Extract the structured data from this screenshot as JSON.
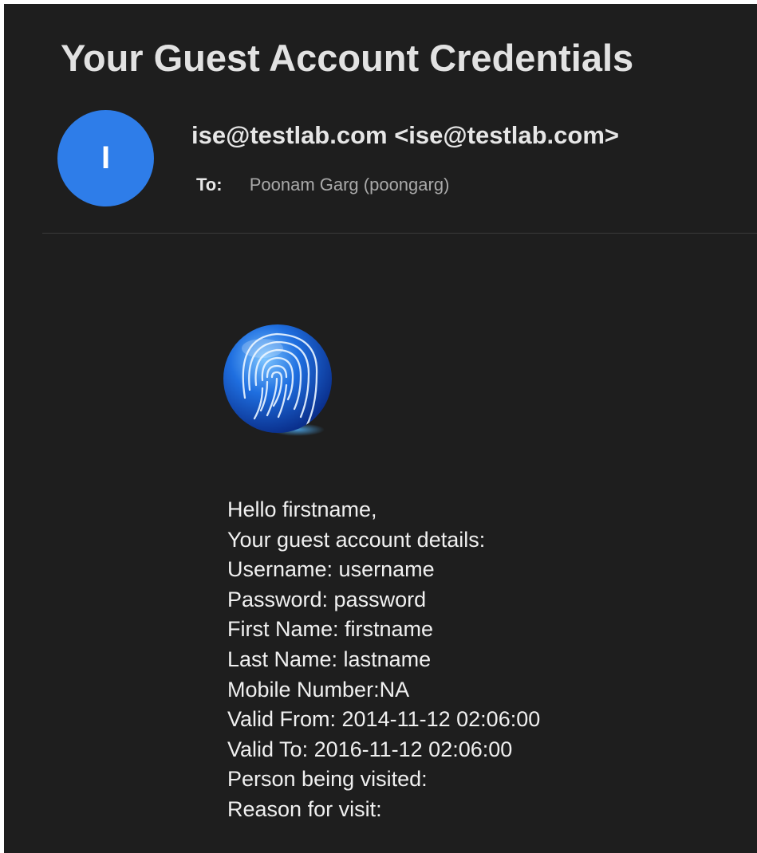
{
  "email": {
    "subject": "Your Guest Account Credentials",
    "avatar_initial": "I",
    "avatar_color": "#2e7de9",
    "sender": "ise@testlab.com <ise@testlab.com>",
    "to_label": "To:",
    "to_value": "Poonam Garg (poongarg)"
  },
  "logo": {
    "icon": "fingerprint-icon",
    "color": "#1f6fe0"
  },
  "body": {
    "greeting": "Hello firstname,",
    "intro": "Your guest account details:",
    "username": "Username: username",
    "password": "Password: password",
    "first_name": "First Name: firstname",
    "last_name": "Last Name: lastname",
    "mobile": "Mobile Number:NA",
    "valid_from": "Valid From: 2014-11-12 02:06:00",
    "valid_to": "Valid To: 2016-11-12 02:06:00",
    "person_visited": "Person being visited:",
    "reason": "Reason for visit:"
  }
}
